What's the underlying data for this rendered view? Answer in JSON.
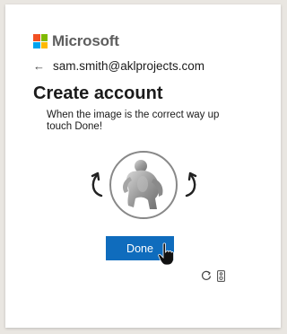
{
  "header": {
    "brand_name": "Microsoft",
    "logo_colors": [
      "#f25022",
      "#7fba00",
      "#00a4ef",
      "#ffb900"
    ]
  },
  "identity": {
    "email": "sam.smith@aklprojects.com",
    "back_icon": "arrow-left-icon"
  },
  "page": {
    "title": "Create account",
    "instruction": "When the image is the correct way up touch Done!"
  },
  "puzzle": {
    "image": "gorilla-figure",
    "rotate_left_icon": "rotate-ccw-icon",
    "rotate_right_icon": "rotate-cw-icon"
  },
  "actions": {
    "done_label": "Done",
    "reload_icon": "refresh-icon",
    "audio_icon": "audio-challenge-icon",
    "accent": "#0f6cbd"
  }
}
